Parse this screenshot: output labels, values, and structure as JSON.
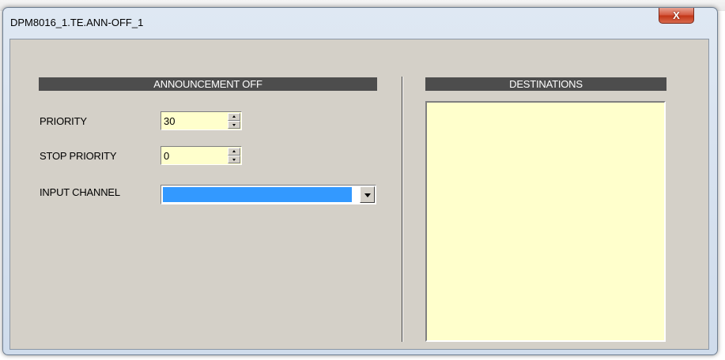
{
  "window": {
    "title": "DPM8016_1.TE.ANN-OFF_1",
    "close_glyph": "X"
  },
  "announcement": {
    "header": "ANNOUNCEMENT OFF",
    "priority_label": "PRIORITY",
    "priority_value": "30",
    "stop_priority_label": "STOP PRIORITY",
    "stop_priority_value": "0",
    "input_channel_label": "INPUT CHANNEL",
    "input_channel_value": ""
  },
  "destinations": {
    "header": "DESTINATIONS",
    "items": []
  },
  "colors": {
    "header_bg": "#4d4d4d",
    "field_bg": "#ffffcc",
    "selection": "#3399ff",
    "panel_bg": "#d4d0c8",
    "close_button": "#c23516"
  }
}
